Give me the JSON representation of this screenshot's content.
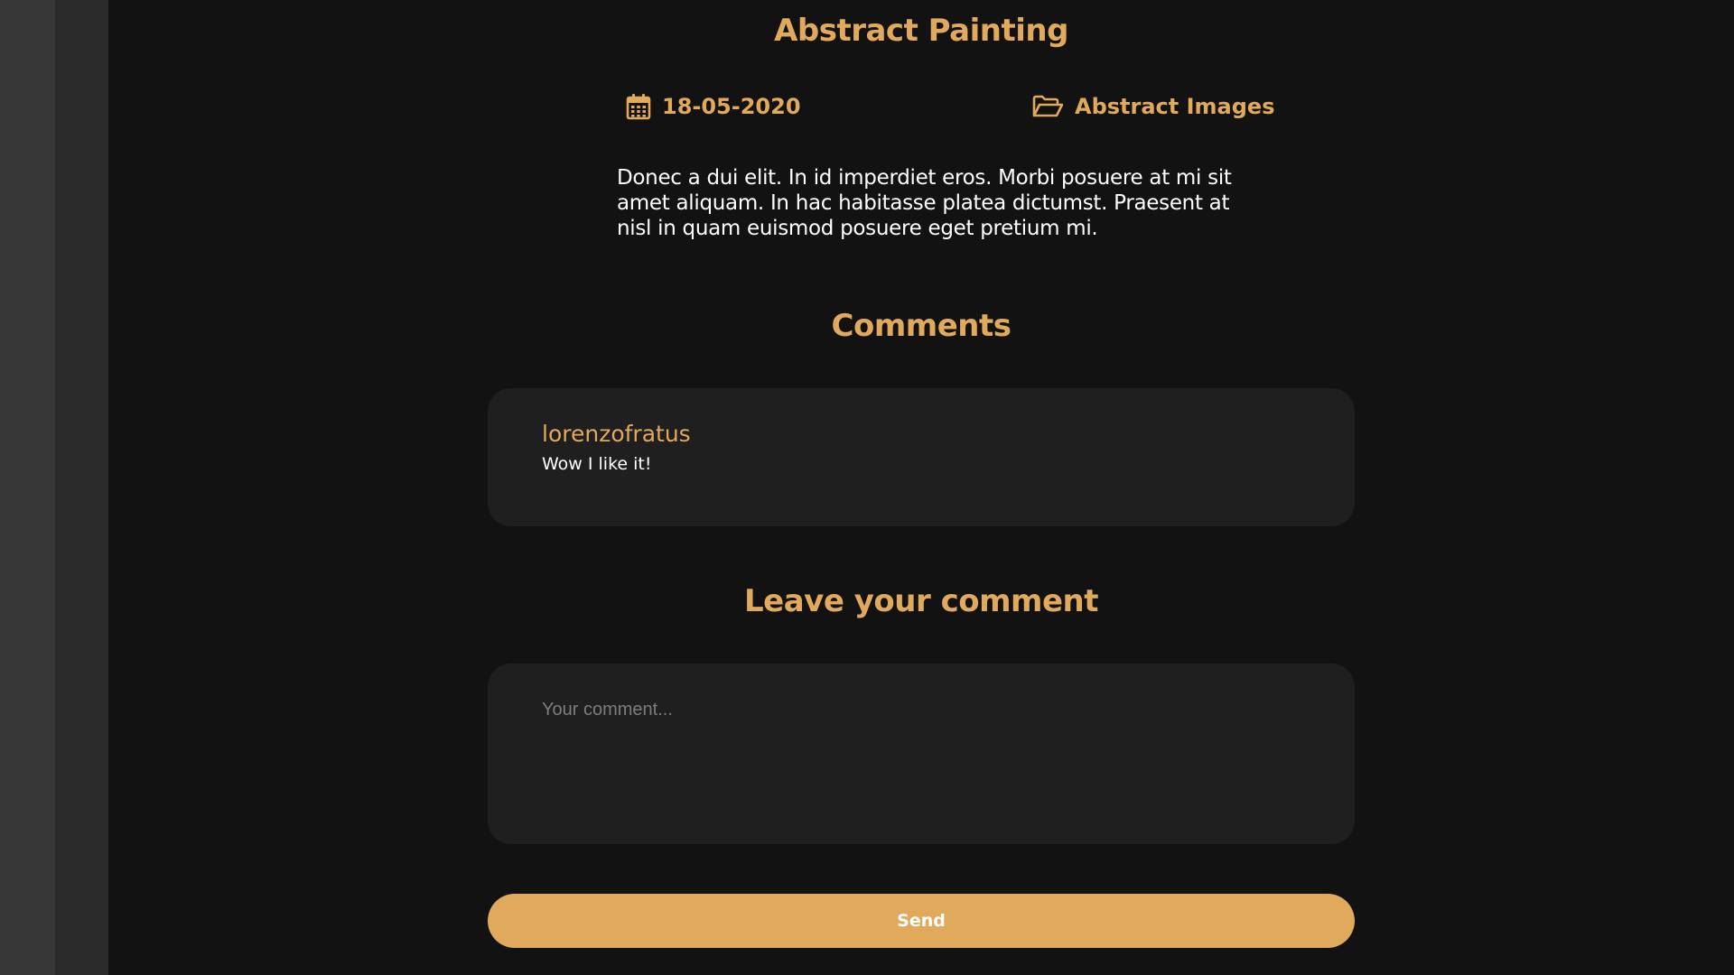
{
  "post": {
    "title": "Abstract Painting",
    "date": "18-05-2020",
    "category": "Abstract Images",
    "body": "Donec a dui elit. In id imperdiet eros. Morbi posuere at mi sit amet aliquam. In hac habitasse platea dictumst. Praesent at nisl in quam euismod posuere eget pretium mi."
  },
  "comments": {
    "heading": "Comments",
    "items": [
      {
        "author": "lorenzofratus",
        "text": "Wow I like it!"
      }
    ]
  },
  "form": {
    "heading": "Leave your comment",
    "placeholder": "Your comment...",
    "send_label": "Send"
  },
  "icons": {
    "date": "calendar-icon",
    "category": "folder-open-icon"
  },
  "colors": {
    "accent": "#e0a95c",
    "background": "#121212",
    "card": "#1f1f1f",
    "rail_outer": "#373737",
    "rail_inner": "#2a2a2a"
  }
}
